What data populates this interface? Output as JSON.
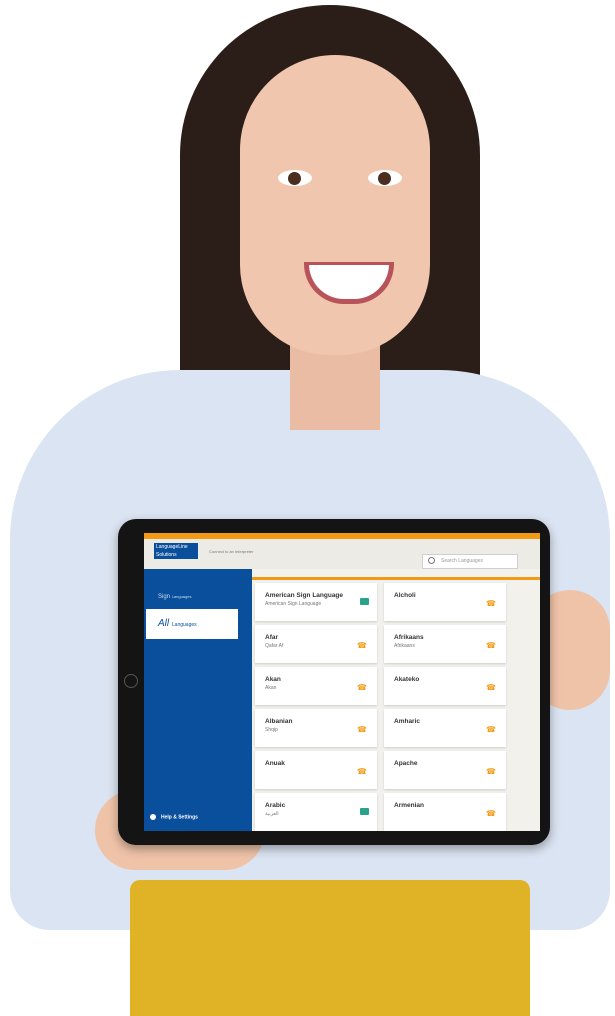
{
  "app": {
    "logo_text": "LanguageLine Solutions",
    "tagline": "Connect to an Interpreter",
    "search_placeholder": "Search Languages"
  },
  "sidebar": {
    "sign_label": "Sign",
    "sign_sub": "Languages",
    "all_label": "All",
    "all_sub": "Languages",
    "help_label": "Help & Settings"
  },
  "cards": [
    {
      "name": "American Sign Language",
      "native": "American Sign Language",
      "type": "video"
    },
    {
      "name": "Alcholi",
      "native": "",
      "type": "phone"
    },
    {
      "name": "Afar",
      "native": "Qafar Af",
      "type": "phone"
    },
    {
      "name": "Afrikaans",
      "native": "Afrikaans",
      "type": "phone"
    },
    {
      "name": "Akan",
      "native": "Akan",
      "type": "phone"
    },
    {
      "name": "Akateko",
      "native": "",
      "type": "phone"
    },
    {
      "name": "Albanian",
      "native": "Shqip",
      "type": "phone"
    },
    {
      "name": "Amharic",
      "native": "",
      "type": "phone"
    },
    {
      "name": "Anuak",
      "native": "",
      "type": "phone"
    },
    {
      "name": "Apache",
      "native": "",
      "type": "phone"
    },
    {
      "name": "Arabic",
      "native": "العربية",
      "type": "video"
    },
    {
      "name": "Armenian",
      "native": "",
      "type": "phone"
    }
  ],
  "colors": {
    "brand_blue": "#0a4f9c",
    "accent_orange": "#f29a16",
    "video_green": "#2aa38b"
  }
}
